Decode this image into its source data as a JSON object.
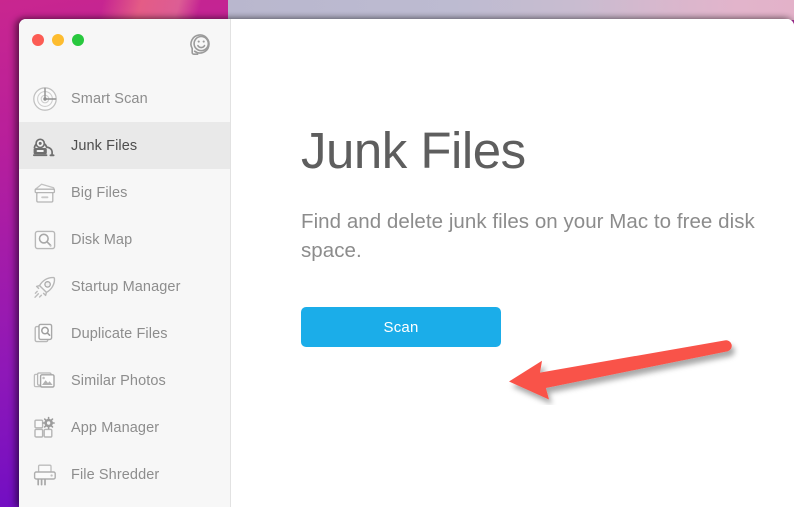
{
  "window": {
    "traffic_lights": [
      {
        "name": "close",
        "color": "#fc5c54",
        "label": "Close"
      },
      {
        "name": "minimize",
        "color": "#fdbc2f",
        "label": "Minimize"
      },
      {
        "name": "zoom",
        "color": "#28c83e",
        "label": "Zoom"
      }
    ],
    "support_icon": "support-smiley-icon"
  },
  "sidebar": {
    "items": [
      {
        "label": "Smart Scan",
        "icon": "radar-scan-icon",
        "selected": false
      },
      {
        "label": "Junk Files",
        "icon": "vacuum-cleaner-icon",
        "selected": true
      },
      {
        "label": "Big Files",
        "icon": "storage-bin-icon",
        "selected": false
      },
      {
        "label": "Disk Map",
        "icon": "disk-magnifier-icon",
        "selected": false
      },
      {
        "label": "Startup Manager",
        "icon": "rocket-icon",
        "selected": false
      },
      {
        "label": "Duplicate Files",
        "icon": "documents-search-icon",
        "selected": false
      },
      {
        "label": "Similar Photos",
        "icon": "photos-stack-icon",
        "selected": false
      },
      {
        "label": "App Manager",
        "icon": "app-grid-gear-icon",
        "selected": false
      },
      {
        "label": "File Shredder",
        "icon": "shredder-icon",
        "selected": false
      }
    ]
  },
  "main": {
    "title": "Junk Files",
    "description": "Find and delete junk files on your Mac to free disk space.",
    "scan_button_label": "Scan",
    "scan_button_color": "#1bade9"
  },
  "annotation": {
    "arrow": "left-pointing-arrow",
    "color": "#f9524a"
  },
  "desktop": {
    "backdrop_gradient_start": "#c9268f",
    "backdrop_gradient_end": "#5c07c9",
    "top_strip_start": "#b9b7ce",
    "top_strip_end": "#e3b2c9"
  }
}
